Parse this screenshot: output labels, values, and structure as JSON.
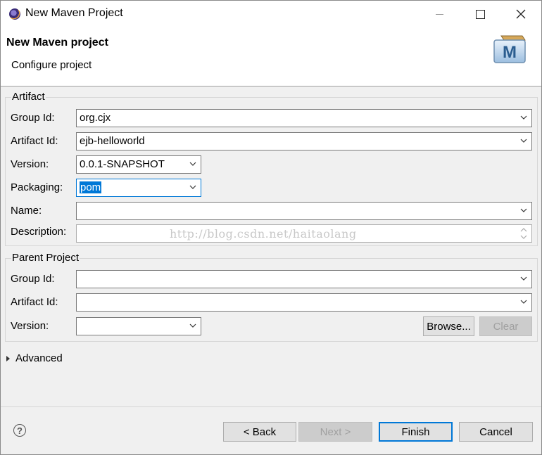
{
  "window": {
    "title": "New Maven Project"
  },
  "header": {
    "title": "New Maven project",
    "subtitle": "Configure project"
  },
  "artifact": {
    "group_label": "Artifact",
    "group_id_label": "Group Id:",
    "group_id_value": "org.cjx",
    "artifact_id_label": "Artifact Id:",
    "artifact_id_value": "ejb-helloworld",
    "version_label": "Version:",
    "version_value": "0.0.1-SNAPSHOT",
    "packaging_label": "Packaging:",
    "packaging_value": "pom",
    "name_label": "Name:",
    "name_value": "",
    "description_label": "Description:",
    "description_value": ""
  },
  "watermark": "http://blog.csdn.net/haitaolang",
  "parent": {
    "group_label": "Parent Project",
    "group_id_label": "Group Id:",
    "artifact_id_label": "Artifact Id:",
    "version_label": "Version:",
    "browse_label": "Browse...",
    "clear_label": "Clear"
  },
  "advanced": {
    "label": "Advanced"
  },
  "footer": {
    "help_icon": "?",
    "back_label": "< Back",
    "next_label": "Next >",
    "finish_label": "Finish",
    "cancel_label": "Cancel"
  },
  "colors": {
    "accent": "#0078d7",
    "window_bg": "#f0f0f0",
    "disabled_text": "#a0a0a0"
  }
}
